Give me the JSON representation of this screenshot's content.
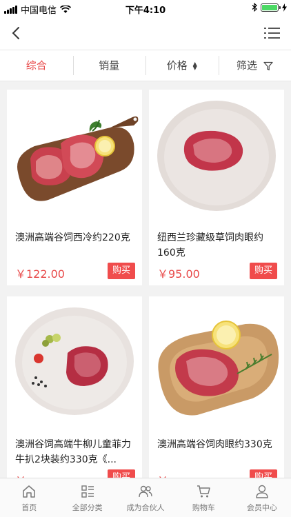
{
  "status_bar": {
    "carrier": "中国电信",
    "time": "下午4:10"
  },
  "navbar": {
    "back_icon": "chevron-left-icon",
    "menu_icon": "list-menu-icon"
  },
  "filters": [
    {
      "label": "综合",
      "active": true
    },
    {
      "label": "销量",
      "active": false
    },
    {
      "label": "价格",
      "active": false
    },
    {
      "label": "筛选",
      "active": false
    }
  ],
  "products": [
    {
      "name": "澳洲高端谷饲西冷约220克",
      "price": "￥122.00",
      "buy_label": "购买"
    },
    {
      "name": "纽西兰珍藏级草饲肉眼约160克",
      "price": "￥95.00",
      "buy_label": "购买"
    },
    {
      "name": "澳洲谷饲高端牛柳儿童菲力牛扒2块装约330克《...",
      "price": "￥...",
      "buy_label": "购买"
    },
    {
      "name": "澳洲高端谷饲肉眼约330克",
      "price": "￥...",
      "buy_label": "购买"
    }
  ],
  "tabbar": [
    {
      "label": "首页",
      "icon": "home-icon"
    },
    {
      "label": "全部分类",
      "icon": "category-icon"
    },
    {
      "label": "成为合伙人",
      "icon": "partner-icon"
    },
    {
      "label": "购物车",
      "icon": "cart-icon"
    },
    {
      "label": "会员中心",
      "icon": "user-icon"
    }
  ],
  "colors": {
    "accent": "#e84a4a",
    "buy_button": "#f04c4c",
    "background": "#f2f2f2"
  }
}
